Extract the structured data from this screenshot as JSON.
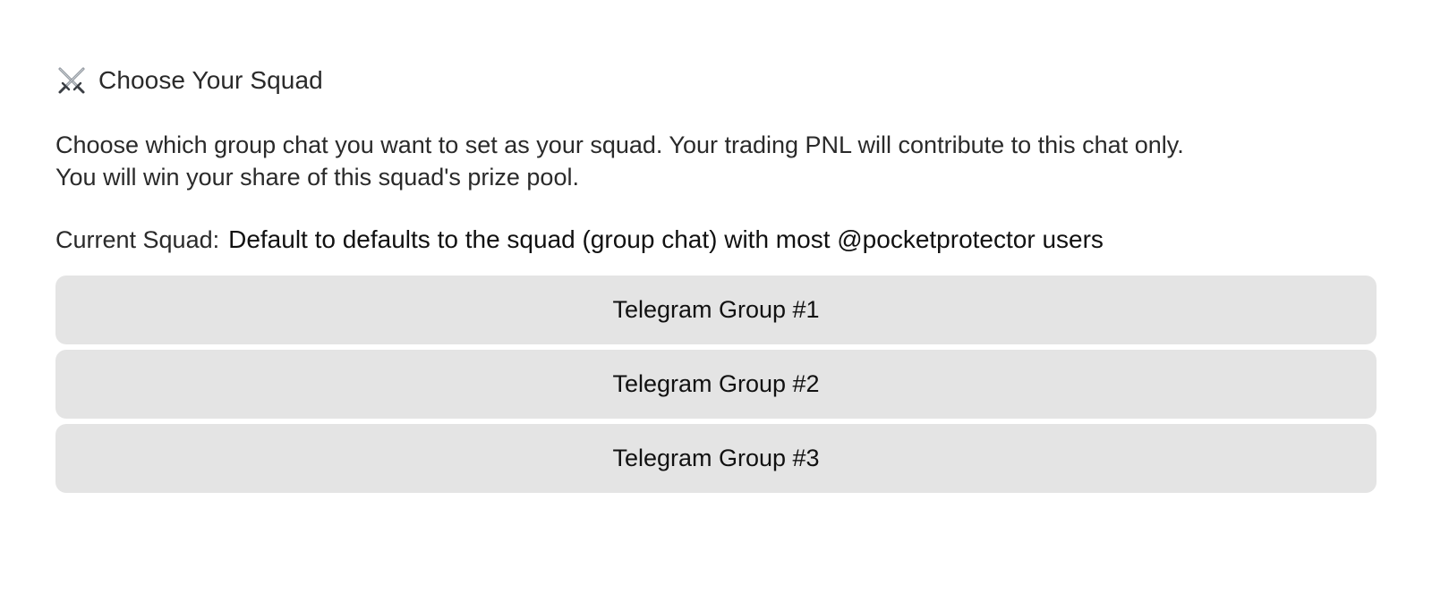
{
  "header": {
    "icon": "crossed-swords-icon",
    "title": "Choose Your Squad"
  },
  "description": {
    "line1": "Choose which group chat you want to set as your squad. Your trading PNL will contribute to this chat only.",
    "line2": "You will win your share of this squad's prize pool."
  },
  "current_squad": {
    "label": "Current Squad:",
    "value": "Default to defaults to the squad (group chat) with most @pocketprotector users"
  },
  "options": [
    {
      "label": "Telegram Group #1"
    },
    {
      "label": "Telegram Group #2"
    },
    {
      "label": "Telegram Group #3"
    }
  ],
  "colors": {
    "button_background": "#e4e4e4",
    "text": "#1c1c1c",
    "page_background": "#ffffff"
  }
}
